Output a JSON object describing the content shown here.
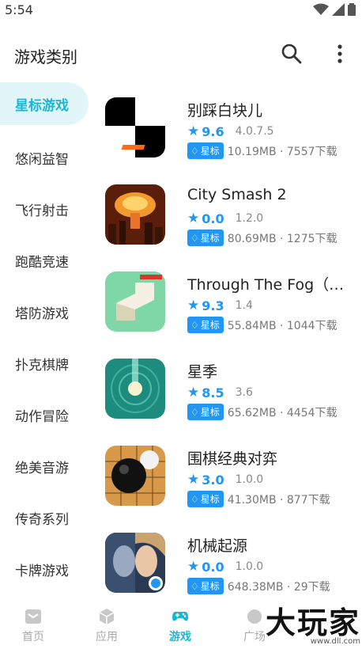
{
  "status": {
    "time": "5:54"
  },
  "header": {
    "title": "游戏类别"
  },
  "sidebar": {
    "items": [
      {
        "label": "星标游戏",
        "active": true
      },
      {
        "label": "悠闲益智"
      },
      {
        "label": "飞行射击"
      },
      {
        "label": "跑酷竞速"
      },
      {
        "label": "塔防游戏"
      },
      {
        "label": "扑克棋牌"
      },
      {
        "label": "动作冒险"
      },
      {
        "label": "绝美音游"
      },
      {
        "label": "传奇系列"
      },
      {
        "label": "卡牌游戏"
      }
    ]
  },
  "apps": [
    {
      "name": "别踩白块儿",
      "score": "9.6",
      "version": "4.0.7.5",
      "badge": "星标",
      "info": "10.19MB · 7557下载",
      "icon": "piano-tiles-icon"
    },
    {
      "name": "City Smash 2",
      "score": "0.0",
      "version": "1.2.0",
      "badge": "星标",
      "info": "80.69MB · 1275下载",
      "icon": "city-smash-icon"
    },
    {
      "name": "Through The Fog（穿越迷雾）",
      "score": "9.3",
      "version": "1.4",
      "badge": "星标",
      "info": "55.84MB · 1044下载",
      "icon": "through-fog-icon"
    },
    {
      "name": "星季",
      "score": "8.5",
      "version": "3.6",
      "badge": "星标",
      "info": "65.62MB · 4454下载",
      "icon": "star-season-icon"
    },
    {
      "name": "围棋经典对弈",
      "score": "3.0",
      "version": "1.0.0",
      "badge": "星标",
      "info": "41.30MB · 877下载",
      "icon": "go-game-icon"
    },
    {
      "name": "机械起源",
      "score": "0.0",
      "version": "1.0.0",
      "badge": "星标",
      "info": "648.38MB · 29下载",
      "icon": "mech-origin-icon"
    }
  ],
  "tabbar": {
    "tabs": [
      {
        "label": "首页",
        "icon": "home-icon"
      },
      {
        "label": "应用",
        "icon": "apps-cube-icon"
      },
      {
        "label": "游戏",
        "icon": "gamepad-icon",
        "active": true
      },
      {
        "label": "广场",
        "icon": "plaza-icon"
      }
    ]
  },
  "watermark": {
    "text": "大玩家",
    "sub": "www.dll.com"
  },
  "colors": {
    "accent": "#1ab7d5",
    "star_blue": "#2196f3",
    "active_bg": "#e2f6f9"
  }
}
